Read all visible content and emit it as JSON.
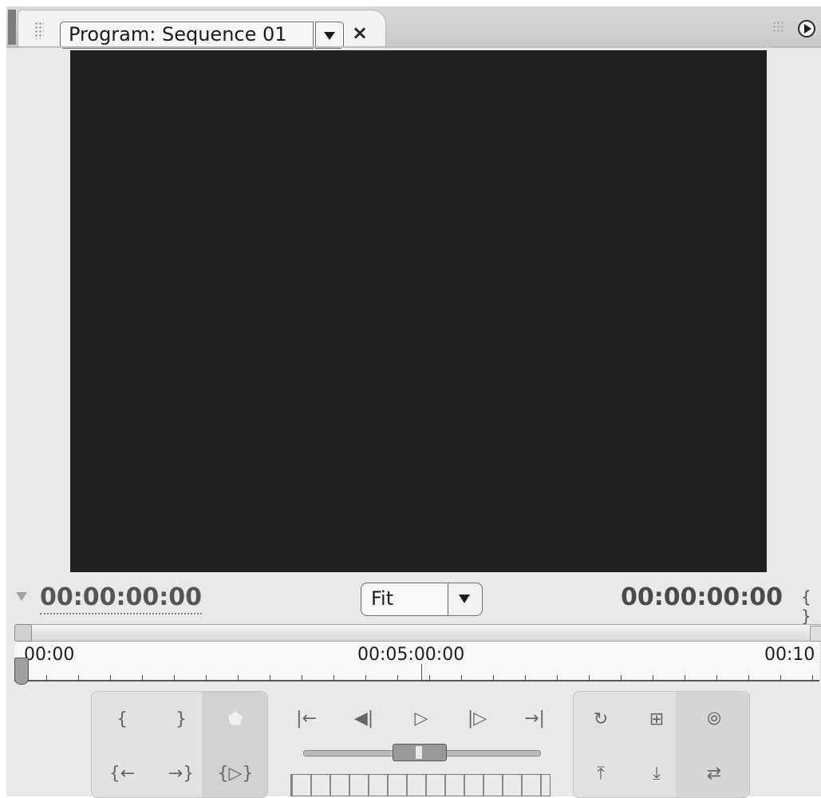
{
  "panel": {
    "tab_title": "Program: Sequence 01",
    "close_glyph": "×"
  },
  "timecode": {
    "current": "00:00:00:00",
    "duration": "00:00:00:00",
    "bracket_glyph": "{ }"
  },
  "zoom": {
    "value": "Fit"
  },
  "ruler": {
    "labels": [
      "00:00",
      "00:05:00:00",
      "00:10"
    ]
  },
  "controls": {
    "group1": {
      "mark_in": "{",
      "mark_out": "}",
      "set_marker": "⬟",
      "go_to_in": "{←",
      "go_to_out": "→}",
      "play_in_to_out": "{▷}"
    },
    "transport": {
      "step_to_start": "|←",
      "step_back": "◀|",
      "play": "▷",
      "step_forward": "|▷",
      "step_to_end": "→|"
    },
    "group3": {
      "loop": "↻",
      "safe_margins": "⊞",
      "output": "⦾",
      "lift": "⤒",
      "extract": "⤓",
      "trim": "⇄"
    }
  },
  "icons": [
    "panel-grip-icon",
    "dropdown-arrow-icon",
    "close-icon",
    "panel-menu-icon",
    "timecode-arrow-icon",
    "playhead-icon"
  ]
}
